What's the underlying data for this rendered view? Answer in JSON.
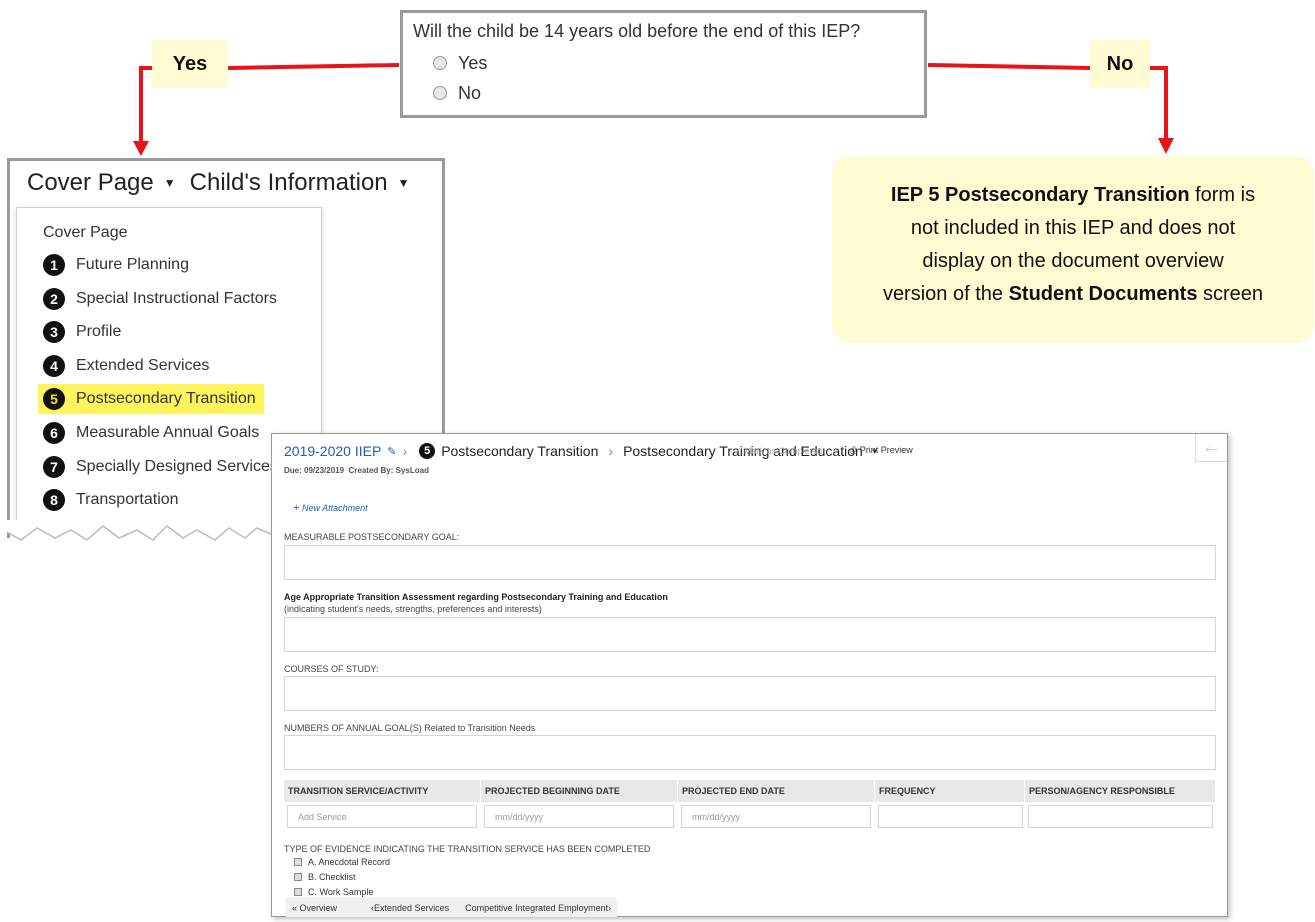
{
  "question": {
    "text": "Will the child be 14 years old before the end of this IEP?",
    "options": [
      "Yes",
      "No"
    ]
  },
  "callouts": {
    "yes_label": "Yes",
    "no_label": "No",
    "no_note": {
      "bold1": "IEP 5 Postsecondary Transition",
      "t1": " form is",
      "t2": "not included in this IEP and does not",
      "t3": "display on the document overview",
      "t4": "version of the ",
      "bold2": "Student Documents",
      "t5": " screen"
    }
  },
  "menu": {
    "tab1": "Cover Page",
    "tab2": "Child's Information",
    "cover_item": "Cover Page",
    "items": [
      {
        "num": "1",
        "label": "Future Planning"
      },
      {
        "num": "2",
        "label": "Special Instructional Factors"
      },
      {
        "num": "3",
        "label": "Profile"
      },
      {
        "num": "4",
        "label": "Extended Services"
      },
      {
        "num": "5",
        "label": "Postsecondary Transition"
      },
      {
        "num": "6",
        "label": "Measurable Annual Goals"
      },
      {
        "num": "7",
        "label": "Specially Designed Services"
      },
      {
        "num": "8",
        "label": "Transportation"
      }
    ]
  },
  "iep": {
    "title": "2019-2020 IIEP",
    "section_num": "5",
    "section": "Postsecondary Transition",
    "subsection": "Postsecondary Training and Education",
    "mark_completed": "Mark as Completed",
    "print_preview": "Print Preview",
    "due": "Due: 09/23/2019",
    "created": "Created By: SysLoad",
    "new_attachment": "New Attachment",
    "goal_label": "MEASURABLE POSTSECONDARY GOAL:",
    "assessment_title": "Age Appropriate Transition Assessment regarding Postsecondary Training and Education",
    "assessment_sub": "(indicating student's needs, strengths, preferences and interests)",
    "courses_label": "COURSES OF STUDY:",
    "numbers_label": "NUMBERS OF ANNUAL GOAL(S) Related to Transition Needs",
    "table_headers": [
      "TRANSITION SERVICE/ACTIVITY",
      "PROJECTED BEGINNING DATE",
      "PROJECTED END DATE",
      "FREQUENCY",
      "PERSON/AGENCY RESPONSIBLE"
    ],
    "table_placeholders": [
      "Add Service",
      "mm/dd/yyyy",
      "mm/dd/yyyy",
      "",
      ""
    ],
    "evidence_label": "TYPE OF EVIDENCE INDICATING THE TRANSITION SERVICE HAS BEEN COMPLETED",
    "evidence_options": [
      "A. Anecdotal Record",
      "B. Checklist",
      "C. Work Sample"
    ],
    "footer": {
      "overview": "Overview",
      "prev": "Extended Services",
      "next": "Competitive Integrated Employment"
    }
  },
  "colors": {
    "callout_bg": "#fffbd2",
    "arrow_red": "#e8141a",
    "link_blue": "#1f5fa8",
    "highlight": "#fff45c"
  }
}
